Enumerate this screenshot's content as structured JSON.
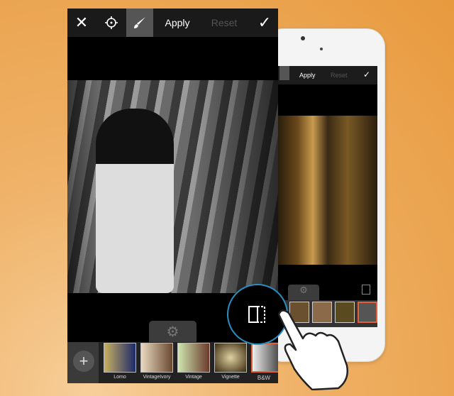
{
  "main_screen": {
    "toolbar": {
      "close_icon": "close-icon",
      "target_icon": "crosshair-icon",
      "brush_icon": "brush-icon",
      "apply_label": "Apply",
      "reset_label": "Reset",
      "confirm_icon": "check-icon"
    },
    "settings_icon": "gear-icon",
    "add_icon": "plus-icon",
    "filters": [
      {
        "label": "Lomo"
      },
      {
        "label": "VintageIvory"
      },
      {
        "label": "Vintage"
      },
      {
        "label": "Vignette"
      },
      {
        "label": "B&W",
        "selected": true
      }
    ],
    "compare_icon": "compare-split-icon"
  },
  "phone_preview": {
    "apply_label": "Apply",
    "reset_label": "Reset"
  },
  "colors": {
    "background": "#e89a3e",
    "accent": "#2a8fc0",
    "selected_filter": "#e0603a"
  }
}
